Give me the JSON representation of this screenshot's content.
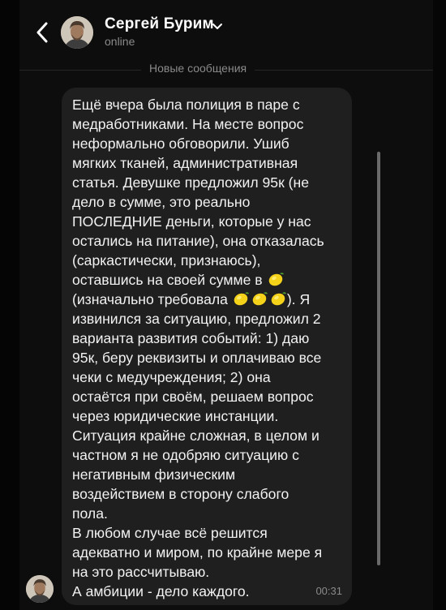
{
  "header": {
    "back_icon": "chevron-left-icon",
    "contact_name": "Сергей Бурим",
    "status": "online",
    "dropdown_icon": "chevron-down-icon"
  },
  "divider": {
    "label": "Новые сообщения"
  },
  "message": {
    "lines": [
      "Ещё вчера была полиция в паре с",
      "медработниками. На месте вопрос",
      "неформально обговорили. Ушиб",
      "мягких тканей, административная",
      "статья. Девушке предложил 95к (не",
      "дело в сумме, это реально",
      "ПОСЛЕДНИЕ деньги, которые у нас",
      "остались на питание), она отказалась",
      "(саркастически, признаюсь),",
      "оставшись на своей сумме в",
      "(изначально требовала",
      "). Я",
      "извинился за ситуацию, предложил 2",
      "варианта развития событий: 1) даю",
      "95к, беру реквизиты и оплачиваю все",
      "чеки с медучреждения; 2) она",
      "остаётся при своём, решаем вопрос",
      "через юридические инстанции.",
      "Ситуация крайне сложная, в целом и",
      "частном я не одобряю ситуацию с",
      "негативным физическим",
      "воздействием в сторону слабого",
      "пола.",
      "В любом случае всё решится",
      "адекватно и миром, по крайне мере я",
      "на это рассчитываю.",
      "А амбиции - дело каждого."
    ],
    "emoji_icon": "lemon-emoji-icon",
    "time": "00:31"
  },
  "colors": {
    "background": "#0d0d0d",
    "bubble": "#1f1f1f",
    "text": "#f2f2f2",
    "secondary_text": "#8a8a8a"
  }
}
